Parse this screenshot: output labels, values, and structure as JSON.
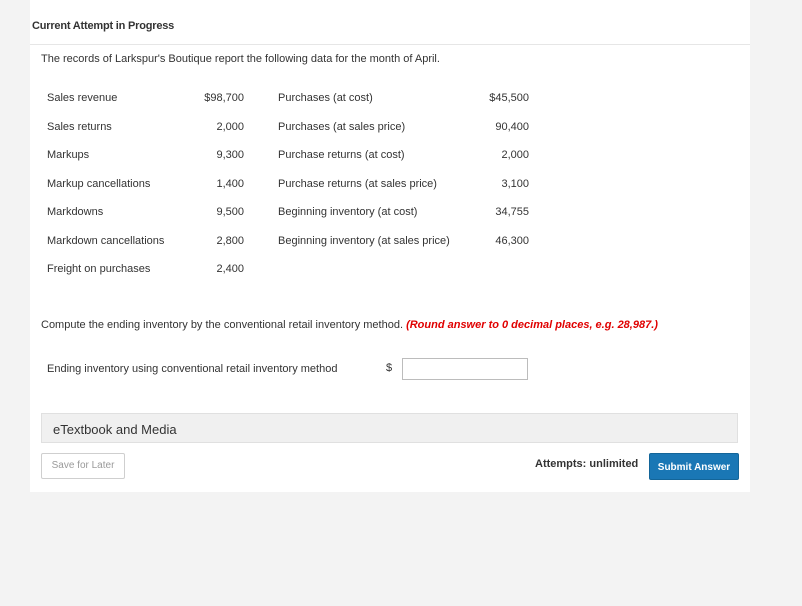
{
  "header": {
    "title": "Current Attempt in Progress"
  },
  "intro": "The records of Larkspur's Boutique report the following data for the month of April.",
  "data_table": {
    "left": [
      {
        "label": "Sales revenue",
        "value": "$98,700"
      },
      {
        "label": "Sales returns",
        "value": "2,000"
      },
      {
        "label": "Markups",
        "value": "9,300"
      },
      {
        "label": "Markup cancellations",
        "value": "1,400"
      },
      {
        "label": "Markdowns",
        "value": "9,500"
      },
      {
        "label": "Markdown cancellations",
        "value": "2,800"
      },
      {
        "label": "Freight on purchases",
        "value": "2,400"
      }
    ],
    "right": [
      {
        "label": "Purchases (at cost)",
        "value": "$45,500"
      },
      {
        "label": "Purchases (at sales price)",
        "value": "90,400"
      },
      {
        "label": "Purchase returns (at cost)",
        "value": "2,000"
      },
      {
        "label": "Purchase returns (at sales price)",
        "value": "3,100"
      },
      {
        "label": "Beginning inventory (at cost)",
        "value": "34,755"
      },
      {
        "label": "Beginning inventory (at sales price)",
        "value": "46,300"
      }
    ]
  },
  "question": {
    "text": "Compute the ending inventory by the conventional retail inventory method.",
    "hint": "(Round answer to 0 decimal places, e.g. 28,987.)"
  },
  "answer": {
    "label": "Ending inventory using conventional retail inventory method",
    "currency": "$",
    "value": "",
    "placeholder": ""
  },
  "media": {
    "label": "eTextbook and Media"
  },
  "footer": {
    "save_label": "Save for Later",
    "attempts_label": "Attempts: unlimited",
    "submit_label": "Submit Answer"
  },
  "colors": {
    "hint_red": "#e00000",
    "submit_blue": "#1a77b5",
    "page_bg": "#f3f3f3"
  }
}
